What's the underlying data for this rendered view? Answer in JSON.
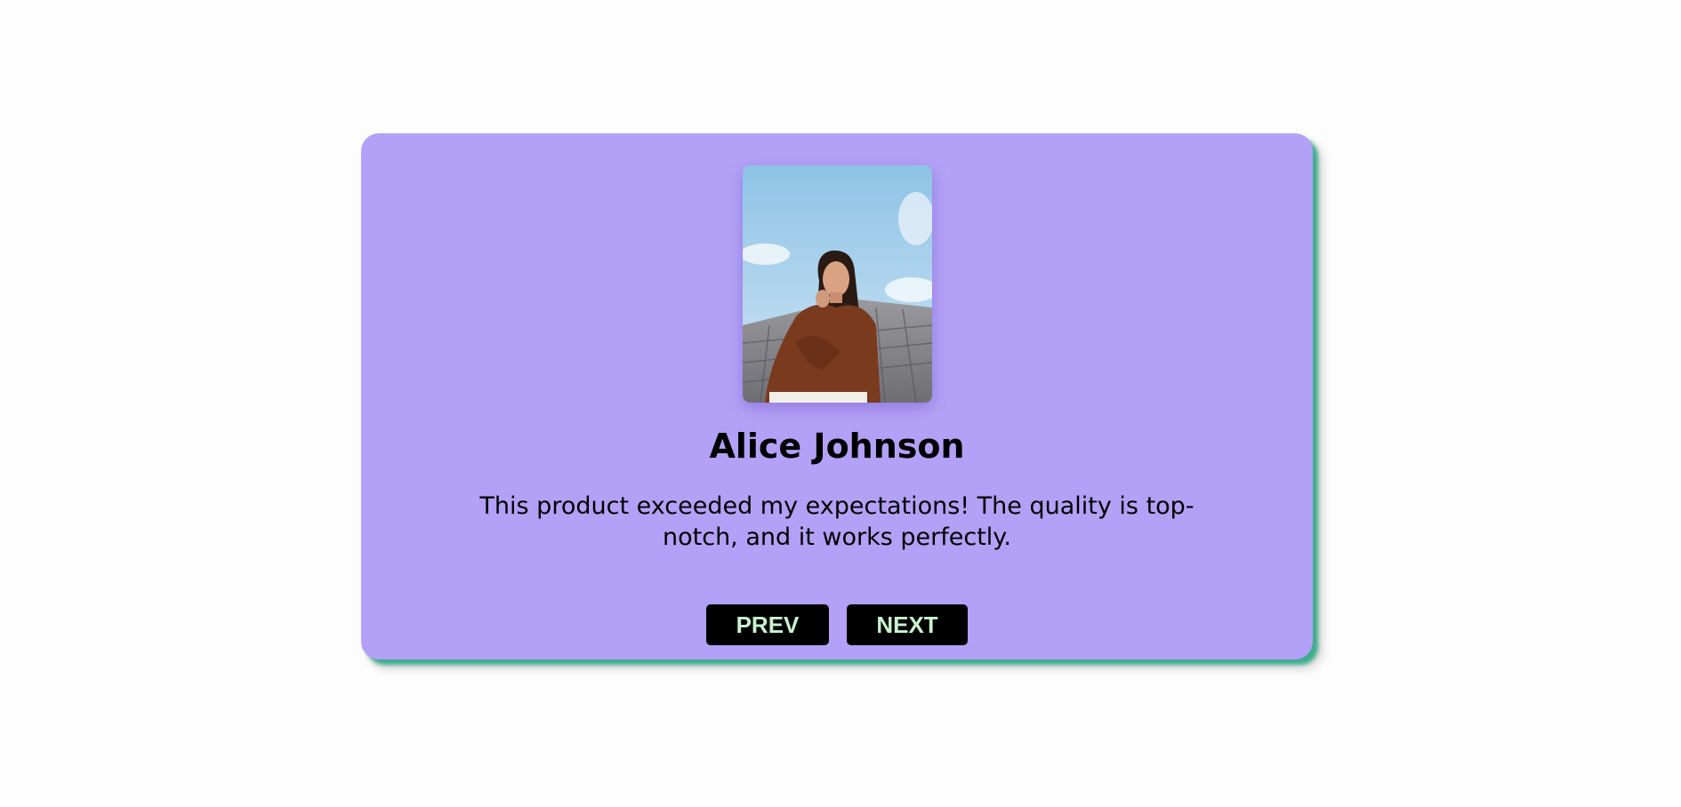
{
  "testimonial": {
    "name": "Alice Johnson",
    "quote": "This product exceeded my expectations! The quality is top-notch, and it works perfectly.",
    "photo_alt": "Alice Johnson"
  },
  "controls": {
    "prev_label": "PREV",
    "next_label": "NEXT"
  },
  "colors": {
    "card_background": "#b3a1f7",
    "card_shadow": "#26a682",
    "button_background": "#000000",
    "button_text": "#c8f2cf"
  }
}
